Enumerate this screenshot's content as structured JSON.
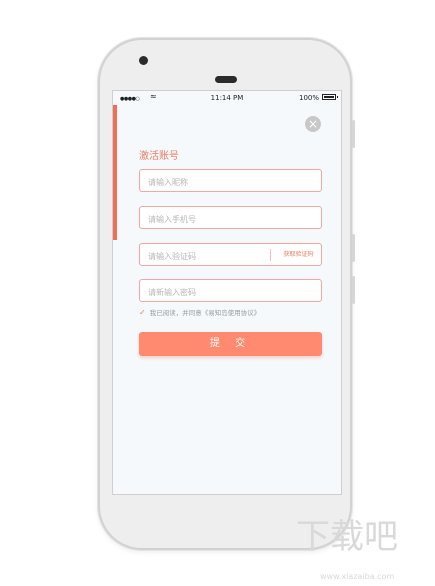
{
  "status_bar": {
    "signal": "●●●●○",
    "wifi_icon": "wifi-icon",
    "time": "11:14 PM",
    "battery": "100%"
  },
  "close_icon": "×",
  "form": {
    "title": "激活账号",
    "nickname_placeholder": "请输入昵称",
    "phone_placeholder": "请输入手机号",
    "code_placeholder": "请输入验证码",
    "get_code_label": "获取验证码",
    "password_placeholder": "请新输入密码",
    "agreement_text": "我已阅读，并同意《易知岛使用协议》",
    "submit_label": "提 交"
  },
  "colors": {
    "accent": "#f46e55",
    "submit_bg": "#ff8a6f",
    "field_border": "#f0a8a0",
    "screen_bg": "#f6f9fc"
  },
  "watermark": {
    "text": "下载吧",
    "sub": "www.xiazaiba.com"
  }
}
